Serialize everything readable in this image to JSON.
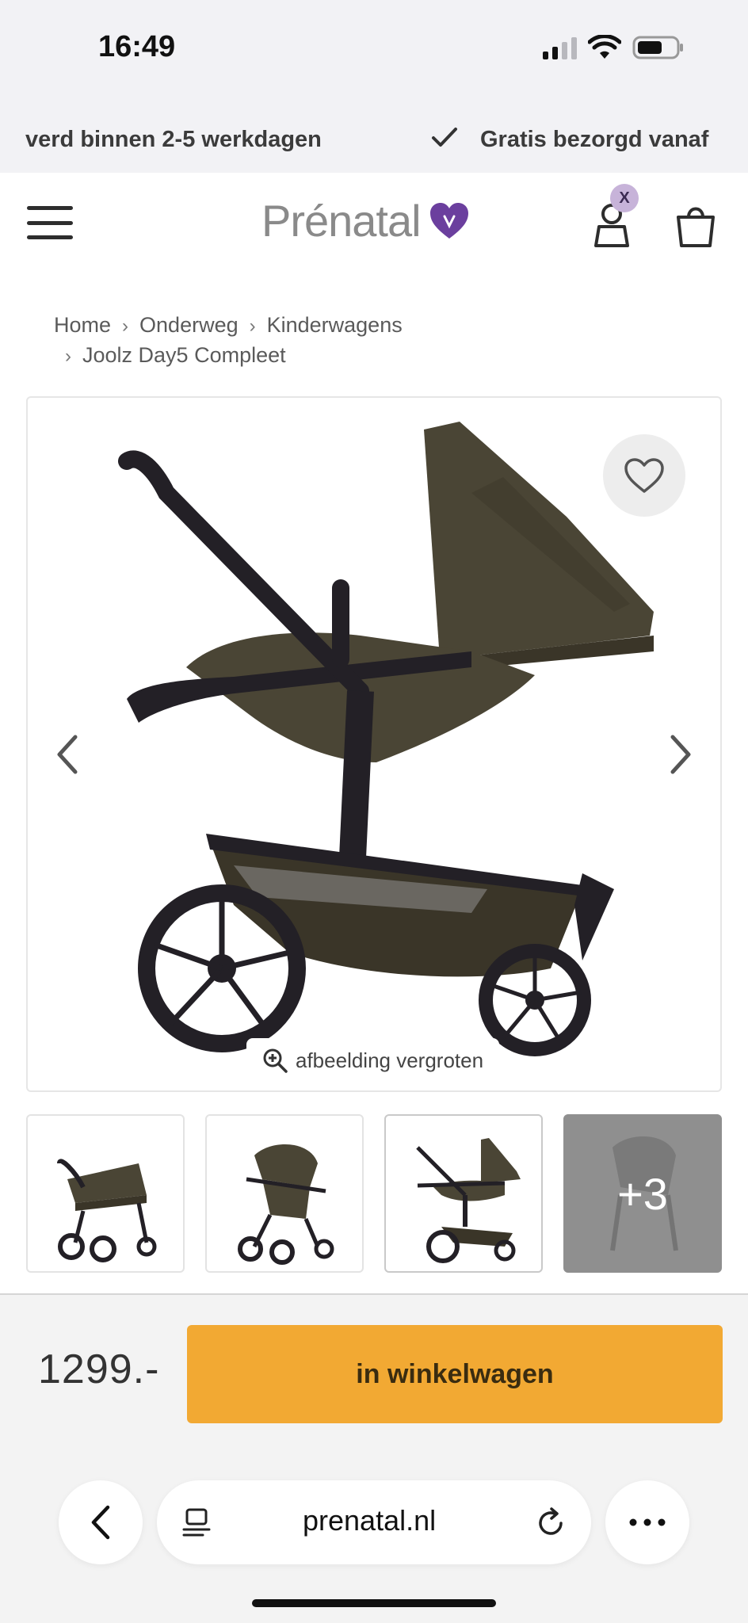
{
  "status_bar": {
    "time": "16:49"
  },
  "promo": {
    "item1": "verd binnen 2-5 werkdagen",
    "item2": "Gratis bezorgd vanaf"
  },
  "header": {
    "logo": "Prénatal",
    "account_badge": "X"
  },
  "breadcrumb": {
    "items": [
      "Home",
      "Onderweg",
      "Kinderwagens",
      "Joolz Day5 Compleet"
    ],
    "separator": "›"
  },
  "gallery": {
    "zoom_label": "afbeelding vergroten",
    "more_count": "+3"
  },
  "purchase": {
    "price": "1299.-",
    "add_to_cart": "in winkelwagen"
  },
  "browser": {
    "url": "prenatal.nl"
  },
  "colors": {
    "brand_purple": "#6b3f9e",
    "cta_orange": "#f2a933",
    "stroller_fabric": "#4a4535",
    "frame": "#232026"
  }
}
